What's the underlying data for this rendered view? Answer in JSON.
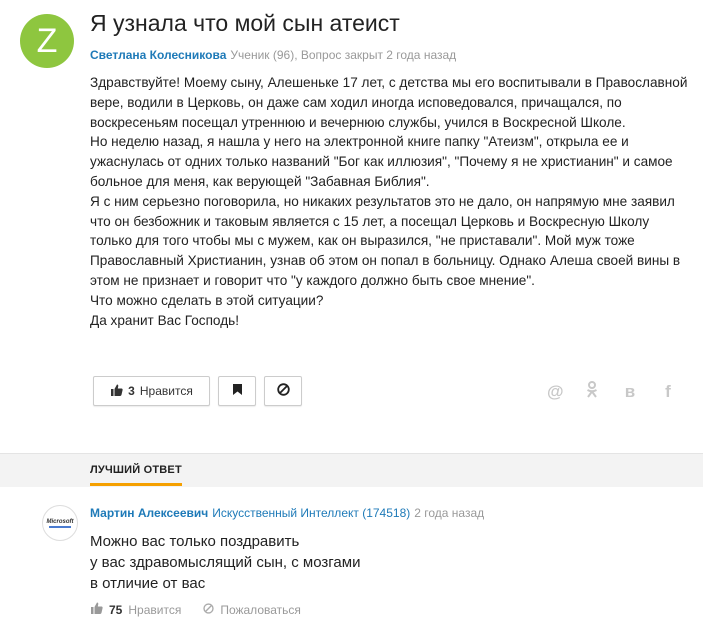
{
  "question": {
    "avatar_letter": "Z",
    "title": "Я узнала что мой сын атеист",
    "author": "Светлана Колесникова",
    "meta": "Ученик (96), Вопрос закрыт 2 года назад",
    "body": [
      "Здравствуйте! Моему сыну, Алешеньке 17 лет, с детства мы его воспитывали в Православной вере, водили в Церковь, он даже сам ходил иногда исповедовался, причащался, по воскресеньям посещал утреннюю и вечернюю службы, учился в Воскресной Школе.",
      "Но неделю назад, я нашла у него на электронной книге папку \"Атеизм\", открыла ее и ужаснулась от одних только названий \"Бог как иллюзия\", \"Почему я не христианин\" и самое больное для меня, как верующей \"Забавная Библия\".",
      "Я с ним серьезно поговорила, но никаких результатов это не дало, он напрямую мне заявил что он безбожник и таковым является с 15 лет, а посещал Церковь и Воскресную Школу только для того чтобы мы с мужем, как он выразился, \"не приставали\". Мой муж тоже Православный Христианин, узнав об этом он попал в больницу. Однако Алеша своей вины в этом не признает и говорит что \"у каждого должно быть свое мнение\".",
      "Что можно сделать в этой ситуации?",
      "Да хранит Вас Господь!"
    ],
    "like_count": "3",
    "like_label": "Нравится",
    "share": [
      "@",
      "ok",
      "в",
      "f"
    ]
  },
  "best_answer_label": "ЛУЧШИЙ ОТВЕТ",
  "answer": {
    "avatar_text": "Microsoft",
    "author": "Мартин Алексеевич",
    "rank": "Искусственный Интеллект (174518)",
    "time": "2 года назад",
    "lines": [
      "Можно вас только поздравить",
      "у вас здравомыслящий сын, с мозгами",
      "в отличие от вас"
    ],
    "like_count": "75",
    "like_label": "Нравится",
    "report_label": "Пожаловаться"
  },
  "colors": {
    "accent": "#1e7ab8",
    "avatar": "#8ec63f",
    "underline": "#f5a000"
  }
}
